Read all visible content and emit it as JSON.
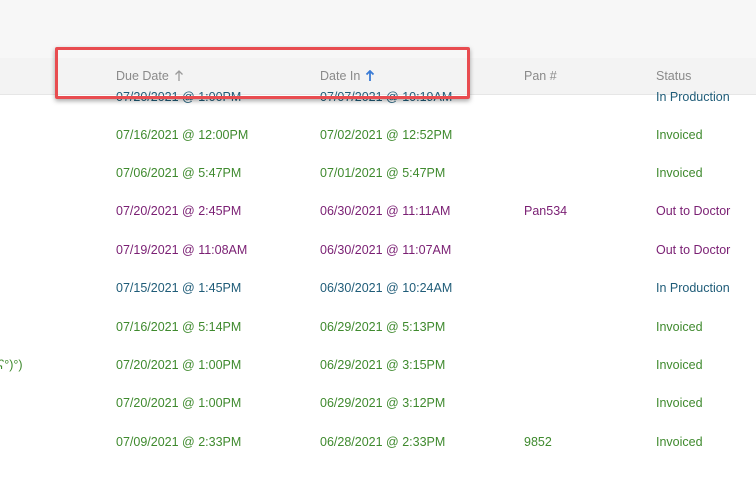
{
  "table": {
    "headers": {
      "due_date": "Due Date",
      "date_in": "Date In",
      "pan": "Pan #",
      "status": "Status"
    },
    "rows": [
      {
        "due": "07/20/2021 @ 1:00PM",
        "date_in": "07/07/2021 @ 10:19AM",
        "pan": "",
        "status": "In Production",
        "color": "blue",
        "extra": ""
      },
      {
        "due": "07/16/2021 @ 12:00PM",
        "date_in": "07/02/2021 @ 12:52PM",
        "pan": "",
        "status": "Invoiced",
        "color": "green",
        "extra": ""
      },
      {
        "due": "07/06/2021 @ 5:47PM",
        "date_in": "07/01/2021 @ 5:47PM",
        "pan": "",
        "status": "Invoiced",
        "color": "green",
        "extra": ""
      },
      {
        "due": "07/20/2021 @ 2:45PM",
        "date_in": "06/30/2021 @ 11:11AM",
        "pan": "Pan534",
        "status": "Out to Doctor",
        "color": "purple",
        "extra": ""
      },
      {
        "due": "07/19/2021 @ 11:08AM",
        "date_in": "06/30/2021 @ 11:07AM",
        "pan": "",
        "status": "Out to Doctor",
        "color": "purple",
        "extra": ""
      },
      {
        "due": "07/15/2021 @ 1:45PM",
        "date_in": "06/30/2021 @ 10:24AM",
        "pan": "",
        "status": "In Production",
        "color": "blue",
        "extra": ""
      },
      {
        "due": "07/16/2021 @ 5:14PM",
        "date_in": "06/29/2021 @ 5:13PM",
        "pan": "",
        "status": "Invoiced",
        "color": "green",
        "extra": ""
      },
      {
        "due": "07/20/2021 @ 1:00PM",
        "date_in": "06/29/2021 @ 3:15PM",
        "pan": "",
        "status": "Invoiced",
        "color": "green",
        "extra": "ʕ°)°)"
      },
      {
        "due": "07/20/2021 @ 1:00PM",
        "date_in": "06/29/2021 @ 3:12PM",
        "pan": "",
        "status": "Invoiced",
        "color": "green",
        "extra": ""
      },
      {
        "due": "07/09/2021 @ 2:33PM",
        "date_in": "06/28/2021 @ 2:33PM",
        "pan": "9852",
        "status": "Invoiced",
        "color": "green",
        "extra": ""
      }
    ]
  },
  "colors": {
    "highlight": "#e84c50",
    "sort_active": "#3a7bd5",
    "sort_inactive": "#9a9a9a",
    "status_green": "#3f8a2e",
    "status_purple": "#7a1f73",
    "status_blue": "#1f5c78"
  },
  "icons": {
    "due_date_sort": "arrow-up-icon",
    "date_in_sort": "arrow-up-active-icon"
  }
}
